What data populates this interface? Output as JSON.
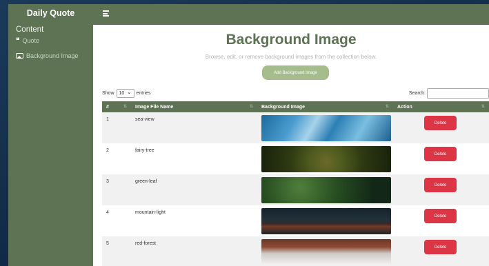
{
  "sidebar": {
    "brand": "Daily Quote",
    "section": "Content",
    "items": [
      {
        "label": "Quote",
        "icon": "quote-icon"
      },
      {
        "label": "Background Image",
        "icon": "image-icon"
      }
    ]
  },
  "main": {
    "title": "Background Image",
    "subtitle": "Browse, edit, or remove background images from the collection below.",
    "add_button": "Add Background Image"
  },
  "table_controls": {
    "show_label": "Show",
    "show_value": "10",
    "entries_label": "entries",
    "search_label": "Search:"
  },
  "table": {
    "columns": [
      "#",
      "Image File Name",
      "Background Image",
      "Action"
    ],
    "rows": [
      {
        "num": "1",
        "name": "sea-view",
        "action": "Delete"
      },
      {
        "num": "2",
        "name": "fairy-tree",
        "action": "Delete"
      },
      {
        "num": "3",
        "name": "green-leaf",
        "action": "Delete"
      },
      {
        "num": "4",
        "name": "mountain-light",
        "action": "Delete"
      },
      {
        "num": "5",
        "name": "red-forest",
        "action": "Delete"
      }
    ]
  },
  "colors": {
    "accent": "#5e7254",
    "button": "#a5bd8c",
    "danger": "#dc3545"
  }
}
